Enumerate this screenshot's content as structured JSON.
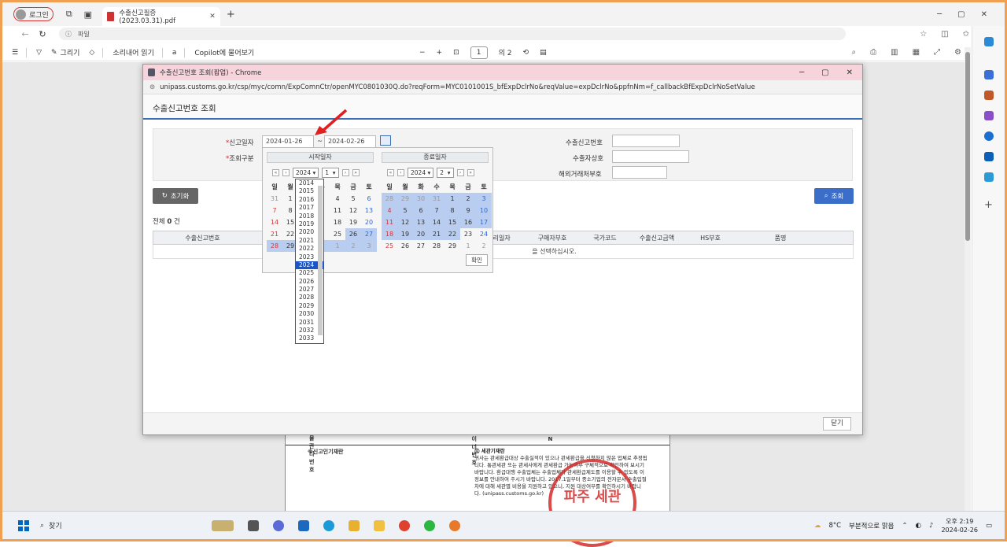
{
  "browser": {
    "profile_label": "로그인",
    "tab_title": "수출신고필증 (2023.03.31).pdf",
    "address_text": "파일"
  },
  "pdf_toolbar": {
    "draw": "그리기",
    "read_aloud": "소리내어 읽기",
    "copilot": "Copilot에 물어보기",
    "page_current": "1",
    "page_total": "의 2"
  },
  "popup": {
    "window_title": "수출신고번호 조회(팝업) - Chrome",
    "url": "unipass.customs.go.kr/csp/myc/comn/ExpComnCtr/openMYC0801030Q.do?reqForm=MYC0101001S_bfExpDclrNo&reqValue=expDclrNo&ppfnNm=f_callbackBfExpDclrNoSetValue",
    "page_title": "수출신고번호 조회"
  },
  "form": {
    "date_label": "신고일자",
    "date_from": "2024-01-26",
    "tilde": "~",
    "date_to": "2024-02-26",
    "type_label": "조회구분",
    "export_no_label": "수출신고번호",
    "exporter_label": "수출자상호",
    "buyer_label": "해외거래처부호",
    "reset": "초기화",
    "search": "조회",
    "total_prefix": "전체",
    "total_count": "0",
    "total_suffix": "건"
  },
  "table": {
    "headers": [
      "수출신고번호",
      "",
      "",
      "",
      "수리일자",
      "구매자부호",
      "국가코드",
      "수출신고금액",
      "HS부호",
      "품명"
    ],
    "empty_msg": "을 선택하십시오.",
    "close": "닫기"
  },
  "calendar": {
    "start_title": "시작일자",
    "end_title": "종료일자",
    "weekdays": [
      "일",
      "월",
      "화",
      "수",
      "목",
      "금",
      "토"
    ],
    "start_year": "2024",
    "start_month": "1",
    "end_year": "2024",
    "end_month": "2",
    "ok": "확인",
    "start_days": [
      "31",
      "1",
      "",
      "",
      "4",
      "5",
      "6",
      "7",
      "8",
      "",
      "",
      "11",
      "12",
      "13",
      "14",
      "15",
      "",
      "",
      "18",
      "19",
      "20",
      "21",
      "22",
      "",
      "",
      "25",
      "26",
      "27",
      "28",
      "29",
      "",
      "",
      "1",
      "2",
      "3"
    ],
    "end_days": [
      "28",
      "29",
      "30",
      "31",
      "1",
      "2",
      "3",
      "4",
      "5",
      "6",
      "7",
      "8",
      "9",
      "10",
      "11",
      "12",
      "13",
      "14",
      "15",
      "16",
      "17",
      "18",
      "19",
      "20",
      "21",
      "22",
      "23",
      "24",
      "25",
      "26",
      "27",
      "28",
      "29",
      "1",
      "2"
    ]
  },
  "years": [
    "2014",
    "2015",
    "2016",
    "2017",
    "2018",
    "2019",
    "2020",
    "2021",
    "2022",
    "2023",
    "2024",
    "2025",
    "2026",
    "2027",
    "2028",
    "2029",
    "2030",
    "2031",
    "2032",
    "2033"
  ],
  "document": {
    "r1a": "⑩ 수입화물 관리번호",
    "r1b": "⑪ 컨테이너번호",
    "r1c": "N",
    "left": "※신고인기재란",
    "right_title": "⑫ 세관기재란",
    "right_text": "귀사는 관세환급대상 수출실적이 있으나 관세환급을 신청하지 않은 업체로 추정됩니다. 통관세관 또는 관세사에게 관세환급 가능여부 구체적으로 확인하여 보시기 바랍니다. 환급대행 수출업체는 수출업체가 관세환급제도를 이용할 수 있도록 이 정보를 안내하여 주시기 바랍니다. 2017.1일부터 중소기업의 전자문서 수출입절차에 대해 세관별 비용을 지원하고 있으니, 지원 대상여부를 확인하시기 바랍니다. (unipass.customs.go.kr)",
    "stamp": "파주 세관"
  },
  "taskbar": {
    "search": "찾기",
    "weather_temp": "8°C",
    "weather_text": "부분적으로 맑음",
    "time": "오후 2:19",
    "date": "2024-02-26"
  }
}
